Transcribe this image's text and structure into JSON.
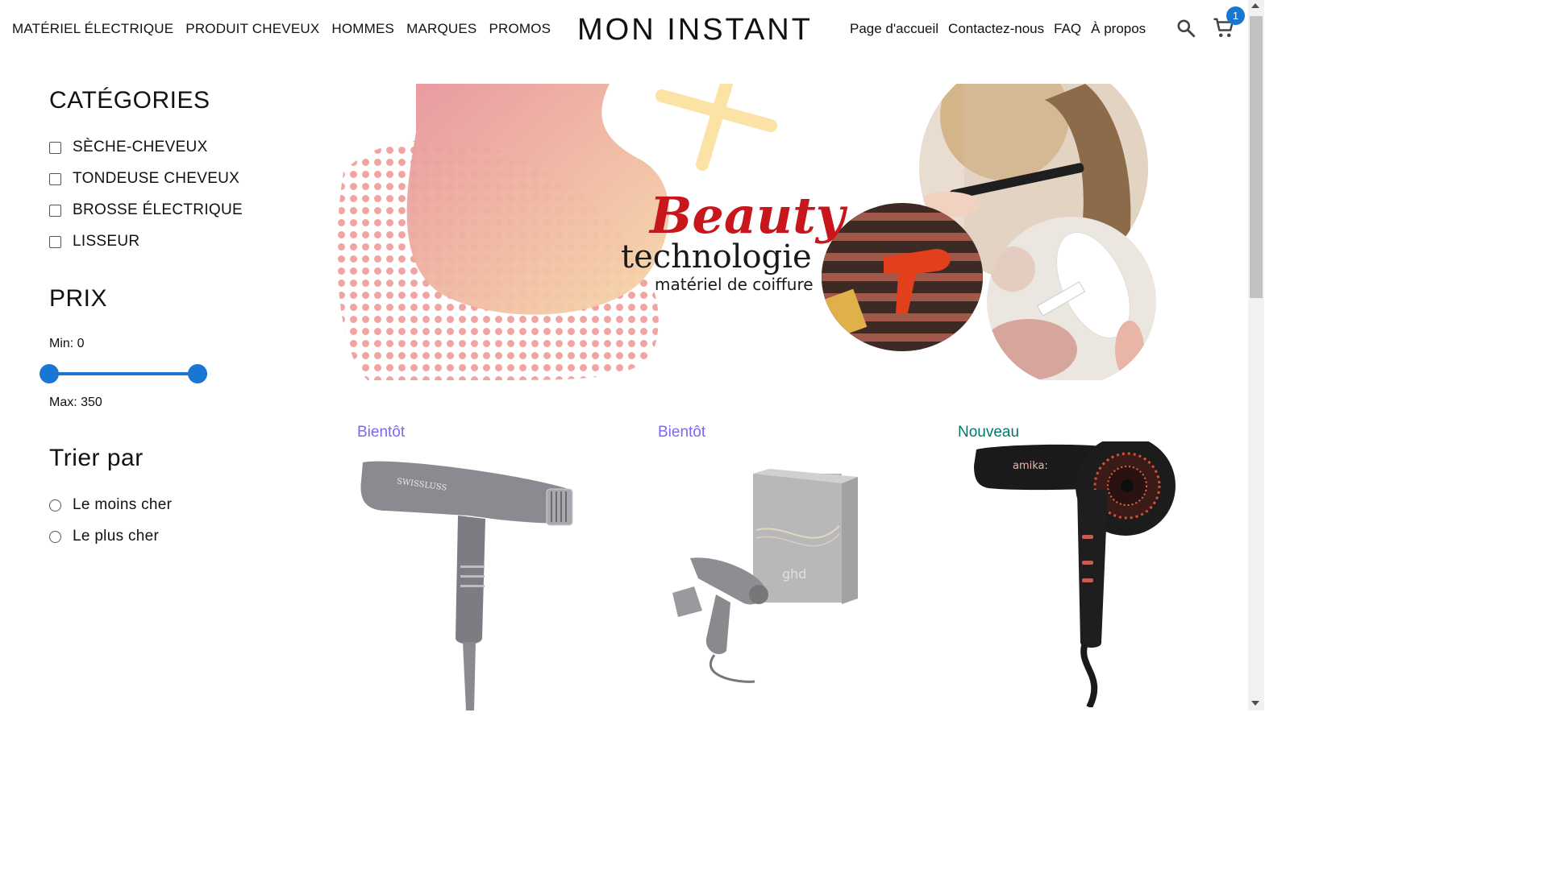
{
  "nav": {
    "left_items": [
      "MATÉRIEL ÉLECTRIQUE",
      "PRODUIT CHEVEUX",
      "HOMMES",
      "MARQUES",
      "PROMOS"
    ],
    "brand": "MON INSTANT",
    "right_items": [
      "Page d'accueil",
      "Contactez-nous",
      "FAQ",
      "À propos"
    ],
    "cart_count": "1",
    "icons": [
      "search-icon",
      "cart-icon"
    ]
  },
  "sidebar": {
    "categories_title": "CATÉGORIES",
    "categories": [
      "SÈCHE-CHEVEUX",
      "TONDEUSE CHEVEUX",
      "BROSSE ÉLECTRIQUE",
      "LISSEUR"
    ],
    "price_title": "PRIX",
    "min_label": "Min: 0",
    "max_label": "Max: 350",
    "price_range": {
      "min": 0,
      "max": 350
    },
    "sort_title": "Trier par",
    "sort_options": [
      "Le moins cher",
      "Le plus cher"
    ]
  },
  "banner": {
    "script_text": "Beauty",
    "main_text": "technologie",
    "sub_text": "matériel de coiffure"
  },
  "products": [
    {
      "tag": "Bientôt",
      "tag_color": "#7b68ee",
      "logo": "SWISSLUSS"
    },
    {
      "tag": "Bientôt",
      "tag_color": "#7b68ee",
      "logo": "ghd"
    },
    {
      "tag": "Nouveau",
      "tag_color": "#00796b",
      "logo": "amika:"
    }
  ],
  "colors": {
    "accent": "#1976d2"
  }
}
